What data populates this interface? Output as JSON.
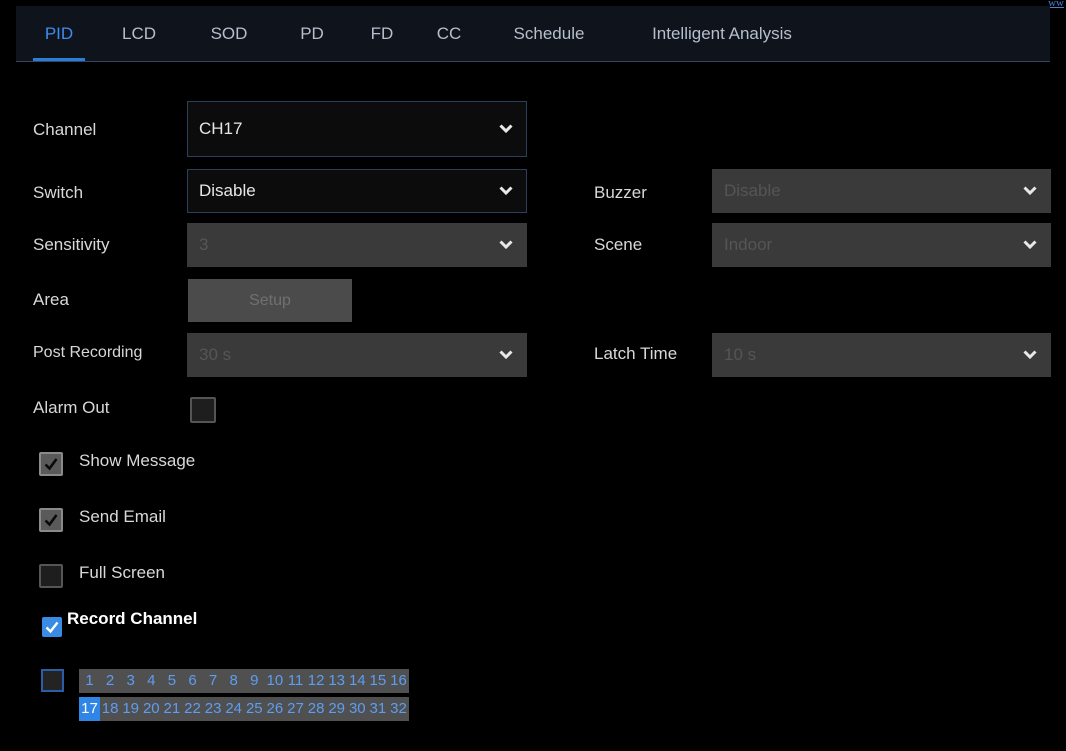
{
  "corner_text": "ww",
  "tabs": [
    {
      "label": "PID",
      "active": true
    },
    {
      "label": "LCD",
      "active": false
    },
    {
      "label": "SOD",
      "active": false
    },
    {
      "label": "PD",
      "active": false
    },
    {
      "label": "FD",
      "active": false
    },
    {
      "label": "CC",
      "active": false
    },
    {
      "label": "Schedule",
      "active": false
    },
    {
      "label": "Intelligent Analysis",
      "active": false
    }
  ],
  "form": {
    "channel": {
      "label": "Channel",
      "value": "CH17"
    },
    "switch": {
      "label": "Switch",
      "value": "Disable"
    },
    "sensitivity": {
      "label": "Sensitivity",
      "value": "3"
    },
    "area": {
      "label": "Area",
      "button": "Setup"
    },
    "post_recording": {
      "label": "Post Recording",
      "value": "30 s"
    },
    "alarm_out": {
      "label": "Alarm Out",
      "checked": false
    },
    "buzzer": {
      "label": "Buzzer",
      "value": "Disable"
    },
    "scene": {
      "label": "Scene",
      "value": "Indoor"
    },
    "latch_time": {
      "label": "Latch Time",
      "value": "10 s"
    }
  },
  "options": {
    "show_message": {
      "label": "Show Message",
      "checked": true
    },
    "send_email": {
      "label": "Send Email",
      "checked": true
    },
    "full_screen": {
      "label": "Full Screen",
      "checked": false
    }
  },
  "record_channel": {
    "label": "Record Channel",
    "checked": true,
    "channels": [
      "1",
      "2",
      "3",
      "4",
      "5",
      "6",
      "7",
      "8",
      "9",
      "10",
      "11",
      "12",
      "13",
      "14",
      "15",
      "16",
      "17",
      "18",
      "19",
      "20",
      "21",
      "22",
      "23",
      "24",
      "25",
      "26",
      "27",
      "28",
      "29",
      "30",
      "31",
      "32"
    ],
    "selected": [
      "17"
    ]
  },
  "colors": {
    "accent": "#2f86e6",
    "background": "#000000"
  }
}
